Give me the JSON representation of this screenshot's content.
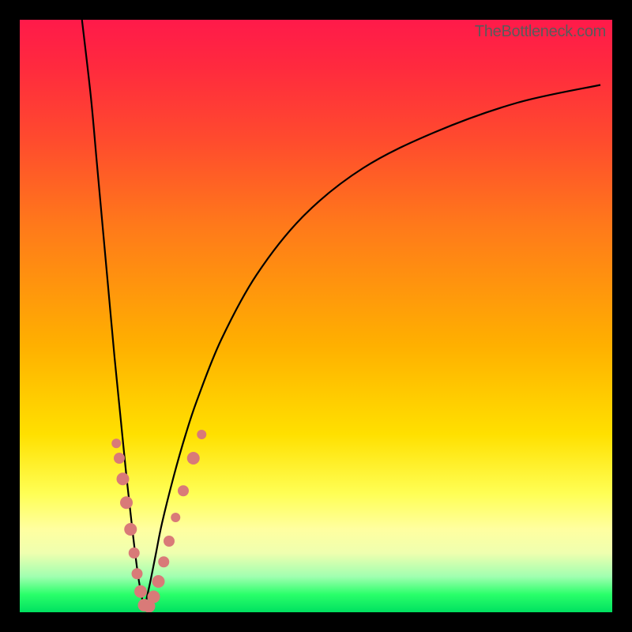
{
  "watermark": "TheBottleneck.com",
  "colors": {
    "frame": "#000000",
    "curve": "#000000",
    "beads": "#d97a78",
    "gradient_top": "#ff1a4a",
    "gradient_bottom": "#00e060"
  },
  "chart_data": {
    "type": "line",
    "title": "",
    "xlabel": "",
    "ylabel": "",
    "xlim": [
      0,
      100
    ],
    "ylim": [
      0,
      100
    ],
    "note": "Two curves descending from top-left and upper-right meeting near the bottom at x≈21, resembling a bottleneck V-shape. Beads cluster along the lower portion of both limbs near the vertex.",
    "series": [
      {
        "name": "left-limb",
        "x": [
          10.5,
          12,
          13,
          14,
          15,
          16,
          17,
          18,
          19,
          20,
          21
        ],
        "y": [
          100,
          87,
          76,
          65,
          54,
          43,
          33,
          23,
          14,
          6,
          0.5
        ]
      },
      {
        "name": "right-limb",
        "x": [
          21,
          22,
          23,
          24,
          26,
          28,
          30,
          34,
          40,
          48,
          58,
          70,
          84,
          98
        ],
        "y": [
          0.5,
          5,
          10,
          15,
          23,
          30,
          36,
          46,
          57,
          67,
          75,
          81,
          86,
          89
        ]
      }
    ],
    "beads": [
      {
        "x": 16.3,
        "y": 28.5,
        "r": 6
      },
      {
        "x": 16.8,
        "y": 26.0,
        "r": 7
      },
      {
        "x": 17.4,
        "y": 22.5,
        "r": 8
      },
      {
        "x": 18.0,
        "y": 18.5,
        "r": 8
      },
      {
        "x": 18.7,
        "y": 14.0,
        "r": 8
      },
      {
        "x": 19.3,
        "y": 10.0,
        "r": 7
      },
      {
        "x": 19.8,
        "y": 6.5,
        "r": 7
      },
      {
        "x": 20.4,
        "y": 3.5,
        "r": 8
      },
      {
        "x": 21.0,
        "y": 1.2,
        "r": 8
      },
      {
        "x": 21.8,
        "y": 1.0,
        "r": 8
      },
      {
        "x": 22.6,
        "y": 2.6,
        "r": 8
      },
      {
        "x": 23.4,
        "y": 5.2,
        "r": 8
      },
      {
        "x": 24.3,
        "y": 8.5,
        "r": 7
      },
      {
        "x": 25.2,
        "y": 12.0,
        "r": 7
      },
      {
        "x": 26.3,
        "y": 16.0,
        "r": 6
      },
      {
        "x": 27.6,
        "y": 20.5,
        "r": 7
      },
      {
        "x": 29.3,
        "y": 26.0,
        "r": 8
      },
      {
        "x": 30.7,
        "y": 30.0,
        "r": 6
      }
    ]
  }
}
